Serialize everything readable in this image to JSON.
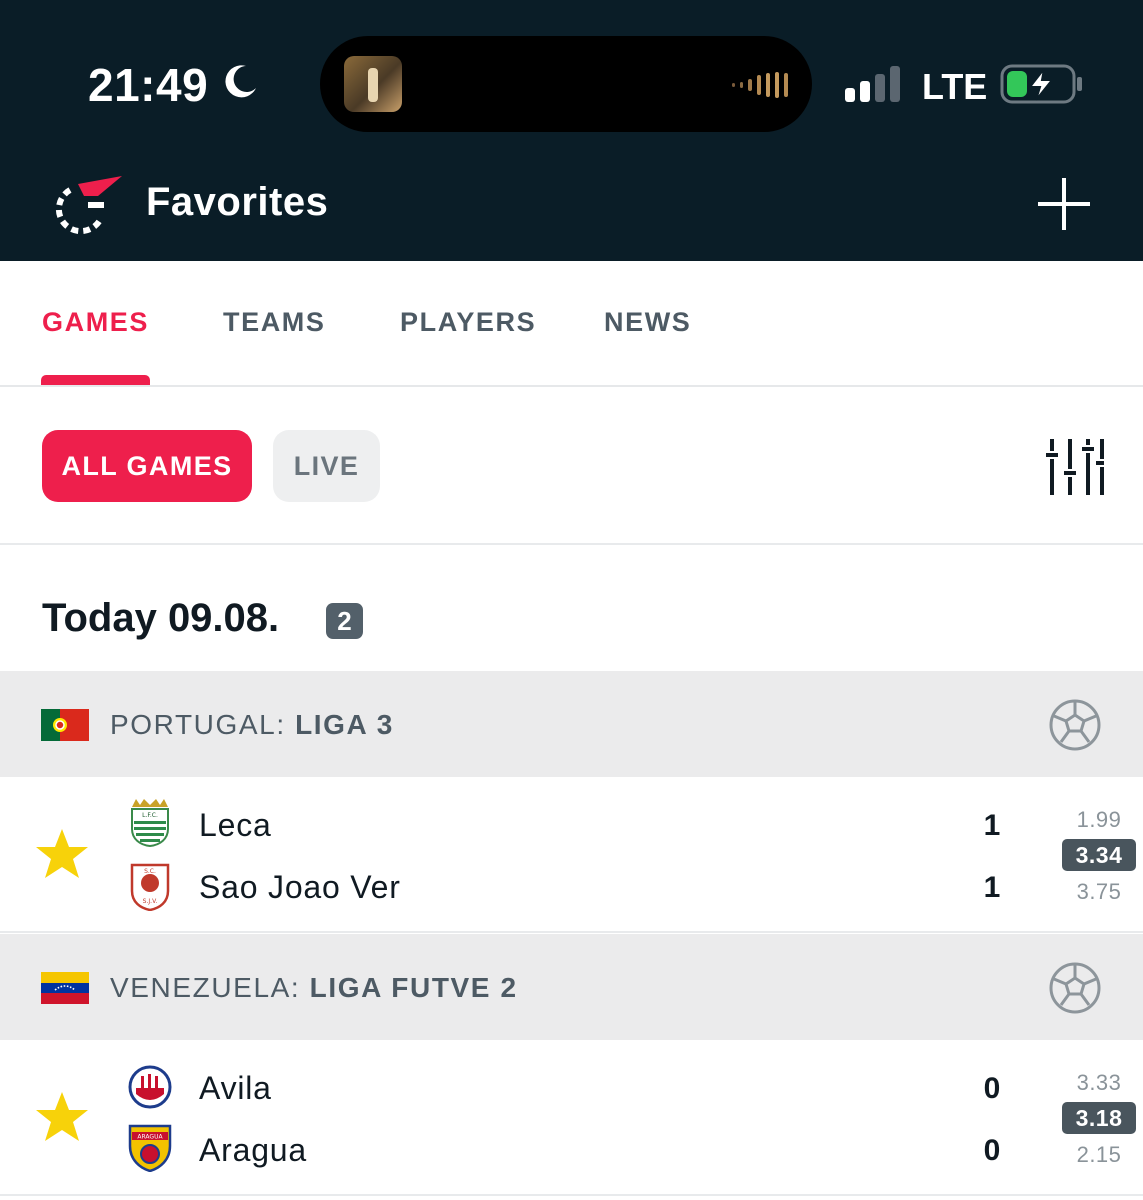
{
  "status_bar": {
    "time": "21:49",
    "network": "LTE"
  },
  "header": {
    "title": "Favorites"
  },
  "tabs": [
    {
      "label": "GAMES"
    },
    {
      "label": "TEAMS"
    },
    {
      "label": "PLAYERS"
    },
    {
      "label": "NEWS"
    }
  ],
  "filters": {
    "all_label": "ALL GAMES",
    "live_label": "LIVE"
  },
  "date_section": {
    "heading": "Today 09.08.",
    "count": "2"
  },
  "leagues": [
    {
      "country": "PORTUGAL:",
      "name": "LIGA 3",
      "match": {
        "home": "Leca",
        "away": "Sao Joao Ver",
        "home_score": "1",
        "away_score": "1",
        "odds": [
          "1.99",
          "3.34",
          "3.75"
        ]
      }
    },
    {
      "country": "VENEZUELA:",
      "name": "LIGA FUTVE 2",
      "match": {
        "home": "Avila",
        "away": "Aragua",
        "home_score": "0",
        "away_score": "0",
        "odds": [
          "3.33",
          "3.18",
          "2.15"
        ]
      }
    }
  ],
  "colors": {
    "accent": "#ee1f4c",
    "header_bg": "#0a1d27",
    "star": "#f7d20a"
  }
}
